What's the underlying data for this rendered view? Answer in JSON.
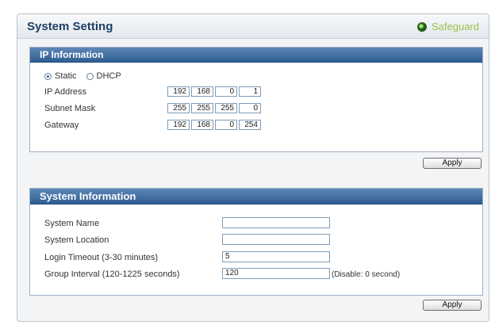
{
  "header": {
    "title": "System Setting",
    "safeguard_label": "Safeguard"
  },
  "ip_information": {
    "title": "IP Information",
    "mode_options": [
      {
        "label": "Static",
        "selected": true
      },
      {
        "label": "DHCP",
        "selected": false
      }
    ],
    "fields": [
      {
        "label": "IP Address",
        "octets": [
          "192",
          "168",
          "0",
          "1"
        ]
      },
      {
        "label": "Subnet Mask",
        "octets": [
          "255",
          "255",
          "255",
          "0"
        ]
      },
      {
        "label": "Gateway",
        "octets": [
          "192",
          "168",
          "0",
          "254"
        ]
      }
    ],
    "apply_label": "Apply"
  },
  "system_information": {
    "title": "System Information",
    "fields": [
      {
        "label": "System Name",
        "value": ""
      },
      {
        "label": "System Location",
        "value": ""
      },
      {
        "label": "Login Timeout (3-30 minutes)",
        "value": "5"
      },
      {
        "label": "Group Interval (120-1225 seconds)",
        "value": "120",
        "hint": "(Disable: 0 second)"
      }
    ],
    "apply_label": "Apply"
  },
  "colors": {
    "section_header": "#2d5d92",
    "title_text": "#1e3f66",
    "safeguard_text": "#9bc24a"
  }
}
